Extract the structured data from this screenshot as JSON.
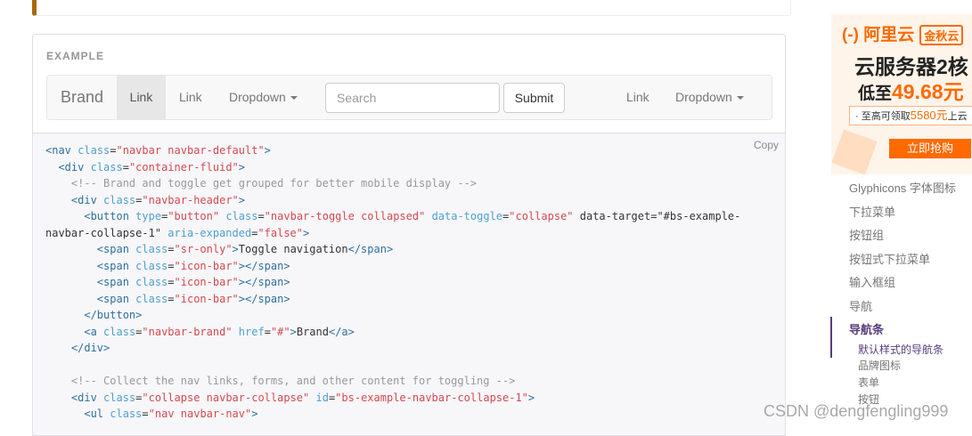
{
  "example": {
    "label": "EXAMPLE",
    "navbar": {
      "brand": "Brand",
      "left_links": [
        "Link",
        "Link"
      ],
      "dropdown_left": "Dropdown",
      "search_placeholder": "Search",
      "submit": "Submit",
      "right_link": "Link",
      "dropdown_right": "Dropdown"
    }
  },
  "code": {
    "copy_label": "Copy",
    "lines": [
      "<nav class=\"navbar navbar-default\">",
      "  <div class=\"container-fluid\">",
      "    <!-- Brand and toggle get grouped for better mobile display -->",
      "    <div class=\"navbar-header\">",
      "      <button type=\"button\" class=\"navbar-toggle collapsed\" data-toggle=\"collapse\" data-target=\"#bs-example-",
      "navbar-collapse-1\" aria-expanded=\"false\">",
      "        <span class=\"sr-only\">Toggle navigation</span>",
      "        <span class=\"icon-bar\"></span>",
      "        <span class=\"icon-bar\"></span>",
      "        <span class=\"icon-bar\"></span>",
      "      </button>",
      "      <a class=\"navbar-brand\" href=\"#\">Brand</a>",
      "    </div>",
      "",
      "    <!-- Collect the nav links, forms, and other content for toggling -->",
      "    <div class=\"collapse navbar-collapse\" id=\"bs-example-navbar-collapse-1\">",
      "      <ul class=\"nav navbar-nav\">"
    ]
  },
  "ad": {
    "brand": "阿里云",
    "tag": "金秋云",
    "headline": "云服务器2核",
    "price_prefix": "低至",
    "price": "49.68元",
    "coupon_prefix": "· 至高可领取",
    "coupon_amount": "5580元",
    "coupon_suffix": "上云",
    "cta": "立即抢购"
  },
  "side_nav": {
    "items": [
      "Glyphicons 字体图标",
      "下拉菜单",
      "按钮组",
      "按钮式下拉菜单",
      "输入框组",
      "导航",
      "导航条"
    ],
    "active_item": "导航条",
    "sub_items": [
      "默认样式的导航条",
      "品牌图标",
      "表单",
      "按钮"
    ]
  },
  "watermark": "CSDN @dengfengling999",
  "colors": {
    "navbar_bg": "#f8f8f8",
    "active_nav": "#563d7c",
    "ad_orange": "#ff6a00",
    "code_tag": "#2f6f9f",
    "code_value": "#d44950"
  }
}
